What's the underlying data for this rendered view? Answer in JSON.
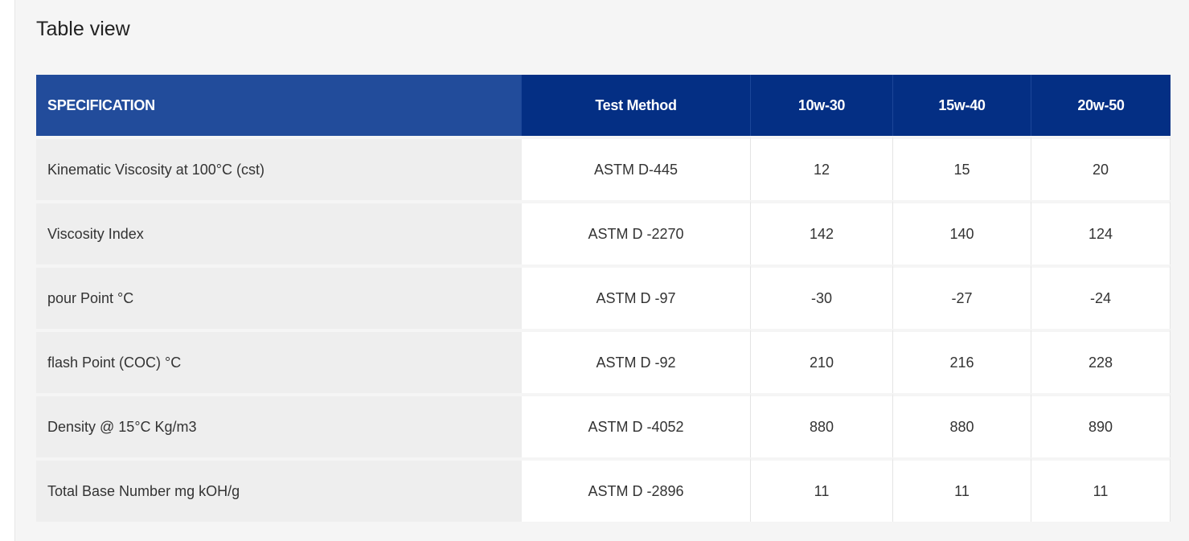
{
  "page": {
    "title": "Table view"
  },
  "colors": {
    "header_primary": "#042f84",
    "header_first_col": "#224c9b",
    "panel_background": "#f5f5f5",
    "first_col_background": "#eeeeee"
  },
  "table": {
    "headers": [
      "SPECIFICATION",
      "Test Method",
      "10w-30",
      "15w-40",
      "20w-50"
    ],
    "rows": [
      [
        "Kinematic Viscosity at 100°C (cst)",
        "ASTM D-445",
        "12",
        "15",
        "20"
      ],
      [
        "Viscosity Index",
        "ASTM D -2270",
        "142",
        "140",
        "124"
      ],
      [
        "pour Point °C",
        "ASTM D -97",
        "-30",
        "-27",
        "-24"
      ],
      [
        "flash Point (COC) °C",
        "ASTM D -92",
        "210",
        "216",
        "228"
      ],
      [
        "Density @ 15°C Kg/m3",
        "ASTM D -4052",
        "880",
        "880",
        "890"
      ],
      [
        "Total Base Number mg kOH/g",
        "ASTM D -2896",
        "11",
        "11",
        "11"
      ]
    ]
  }
}
